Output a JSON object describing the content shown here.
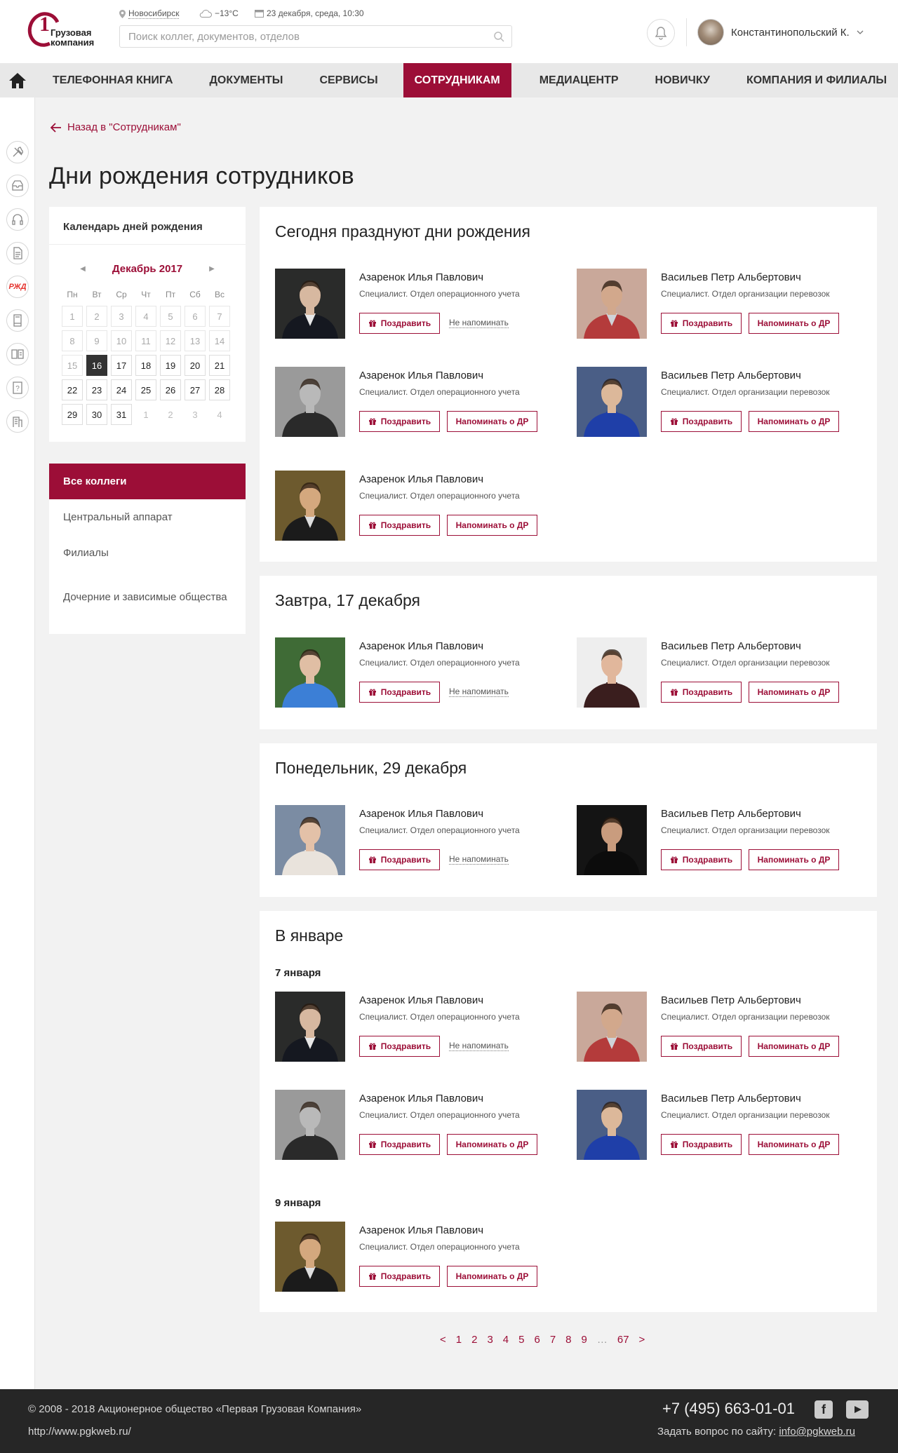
{
  "header": {
    "logo_text_1": "Грузовая",
    "logo_text_2": "компания",
    "logo_number": "1",
    "city": "Новосибирск",
    "weather": "−13°C",
    "datetime": "23 декабря, среда, 10:30",
    "search_placeholder": "Поиск коллег, документов, отделов",
    "user_name": "Константинопольский К."
  },
  "nav": {
    "items": [
      {
        "label": "Телефонная книга"
      },
      {
        "label": "Документы"
      },
      {
        "label": "Сервисы"
      },
      {
        "label": "Сотрудникам",
        "active": true
      },
      {
        "label": "Медиацентр"
      },
      {
        "label": "Новичку"
      },
      {
        "label": "Компания и филиалы"
      }
    ]
  },
  "rail": {
    "icons": [
      "tools-icon",
      "inbox-icon",
      "headset-icon",
      "documents-icon",
      "rzd-logo-icon",
      "book-icon",
      "library-icon",
      "help-icon",
      "building-icon"
    ]
  },
  "page": {
    "back_link": "Назад в \"Сотрудникам\"",
    "title": "Дни рождения сотрудников"
  },
  "calendar": {
    "heading": "Календарь дней рождения",
    "month": "Декабрь 2017",
    "weekdays": [
      "Пн",
      "Вт",
      "Ср",
      "Чт",
      "Пт",
      "Сб",
      "Вс"
    ],
    "today": "16",
    "past": [
      "1",
      "2",
      "3",
      "4",
      "5",
      "6",
      "7",
      "8",
      "9",
      "10",
      "11",
      "12",
      "13",
      "14",
      "15"
    ],
    "current": [
      "16",
      "17",
      "18",
      "19",
      "20",
      "21",
      "22",
      "23",
      "24",
      "25",
      "26",
      "27",
      "28",
      "29",
      "30",
      "31"
    ],
    "next": [
      "1",
      "2",
      "3",
      "4"
    ]
  },
  "filter": {
    "items": [
      "Все коллеги",
      "Центральный аппарат",
      "Филиалы",
      "Дочерние и зависимые общества"
    ]
  },
  "labels": {
    "congratulate": "Поздравить",
    "remind": "Напоминать о ДР",
    "dont_remind": "Не напоминать"
  },
  "people": {
    "a": {
      "name": "Азаренок Илья Павлович",
      "position": "Специалист. Отдел операционного учета"
    },
    "v": {
      "name": "Васильев Петр Альбертович",
      "position": "Специалист. Отдел организации перевозок"
    }
  },
  "sections": {
    "today": "Сегодня празднуют дни рождения",
    "tomorrow": "Завтра, 17 декабря",
    "monday": "Понедельник, 29 декабря",
    "january": "В январе",
    "jan7": "7 января",
    "jan9": "9 января"
  },
  "pagination": [
    "<",
    "1",
    "2",
    "3",
    "4",
    "5",
    "6",
    "7",
    "8",
    "9",
    "…",
    "67",
    ">"
  ],
  "footer": {
    "copyright": "© 2008 - 2018 Акционерное общество «Первая Грузовая Компания»",
    "url": "http://www.pgkweb.ru/",
    "phone": "+7 (495) 663-01-01",
    "ask_label": "Задать вопрос по сайту:",
    "ask_email": "info@pgkweb.ru"
  }
}
